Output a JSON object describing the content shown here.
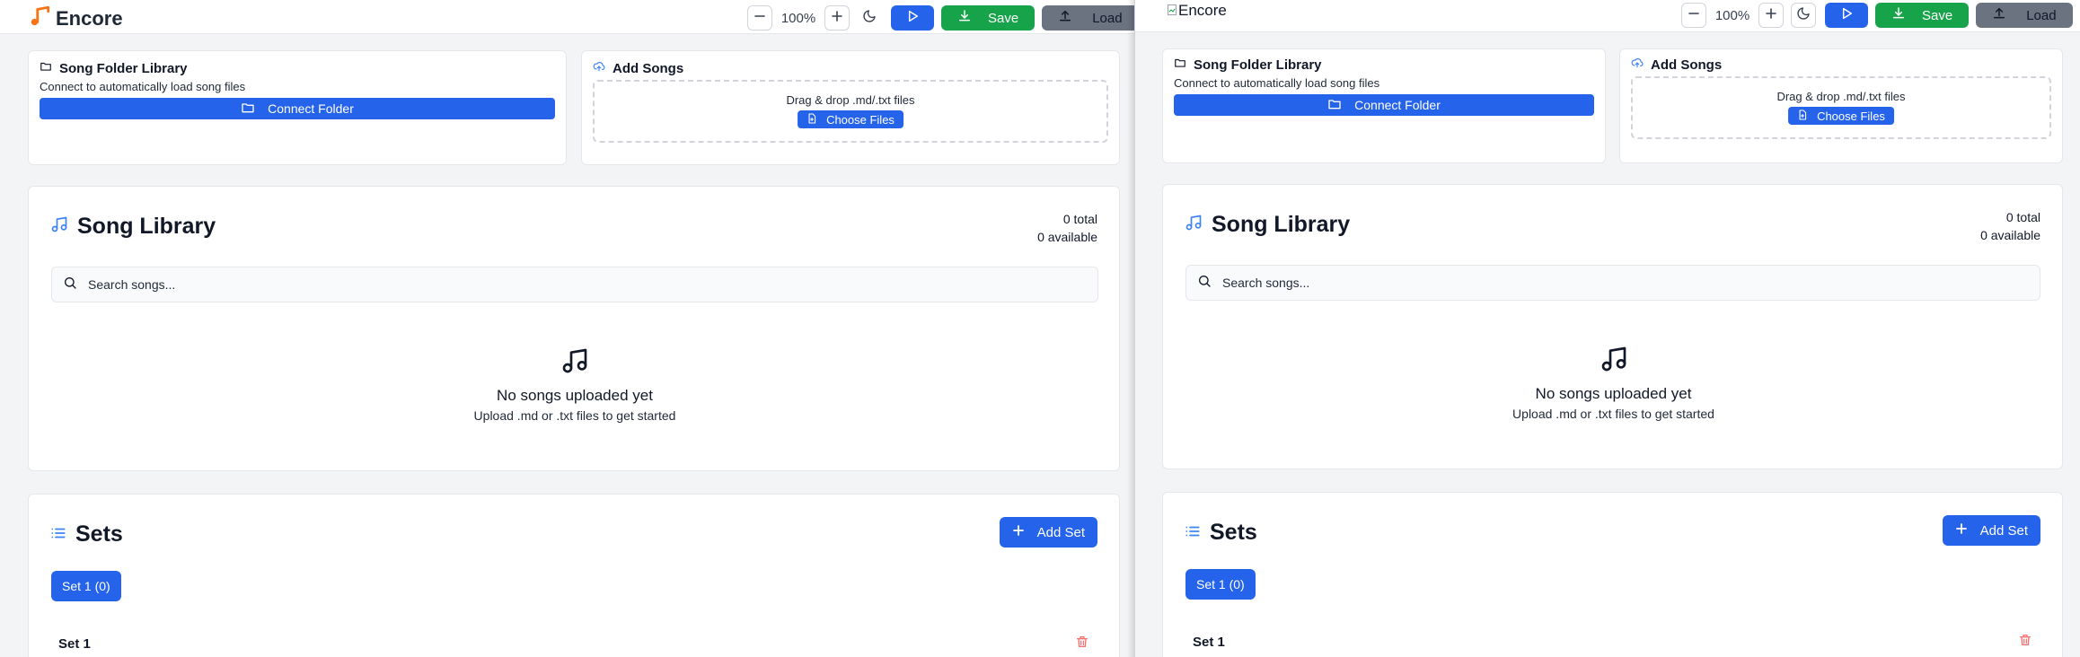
{
  "app": {
    "brand": "Encore",
    "broken_logo_alt": "Encore"
  },
  "toolbar": {
    "zoom": "100%",
    "save_label": "Save",
    "load_label": "Load"
  },
  "folder_library": {
    "title": "Song Folder Library",
    "description": "Connect to automatically load song files",
    "connect_label": "Connect Folder"
  },
  "add_songs": {
    "title": "Add Songs",
    "drop_text": "Drag & drop .md/.txt files",
    "choose_label": "Choose Files"
  },
  "song_library": {
    "title": "Song Library",
    "total": "0 total",
    "available": "0 available",
    "search_placeholder": "Search songs...",
    "empty_title": "No songs uploaded yet",
    "empty_sub": "Upload .md or .txt files to get started"
  },
  "sets": {
    "title": "Sets",
    "add_label": "Add Set",
    "tab_label": "Set 1 (0)",
    "set_name": "Set 1"
  },
  "colors": {
    "accent": "#2563eb",
    "save": "#16a34a",
    "load": "#6b7280",
    "brand_icon": "#f97316",
    "trash": "#f87171"
  },
  "icons": [
    "music-note-brand-icon",
    "minus-icon",
    "plus-icon",
    "moon-icon",
    "play-icon",
    "download-icon",
    "upload-icon",
    "folder-icon",
    "cloud-upload-icon",
    "file-plus-icon",
    "music-icon",
    "search-icon",
    "list-icon",
    "trash-icon",
    "broken-image-icon"
  ]
}
